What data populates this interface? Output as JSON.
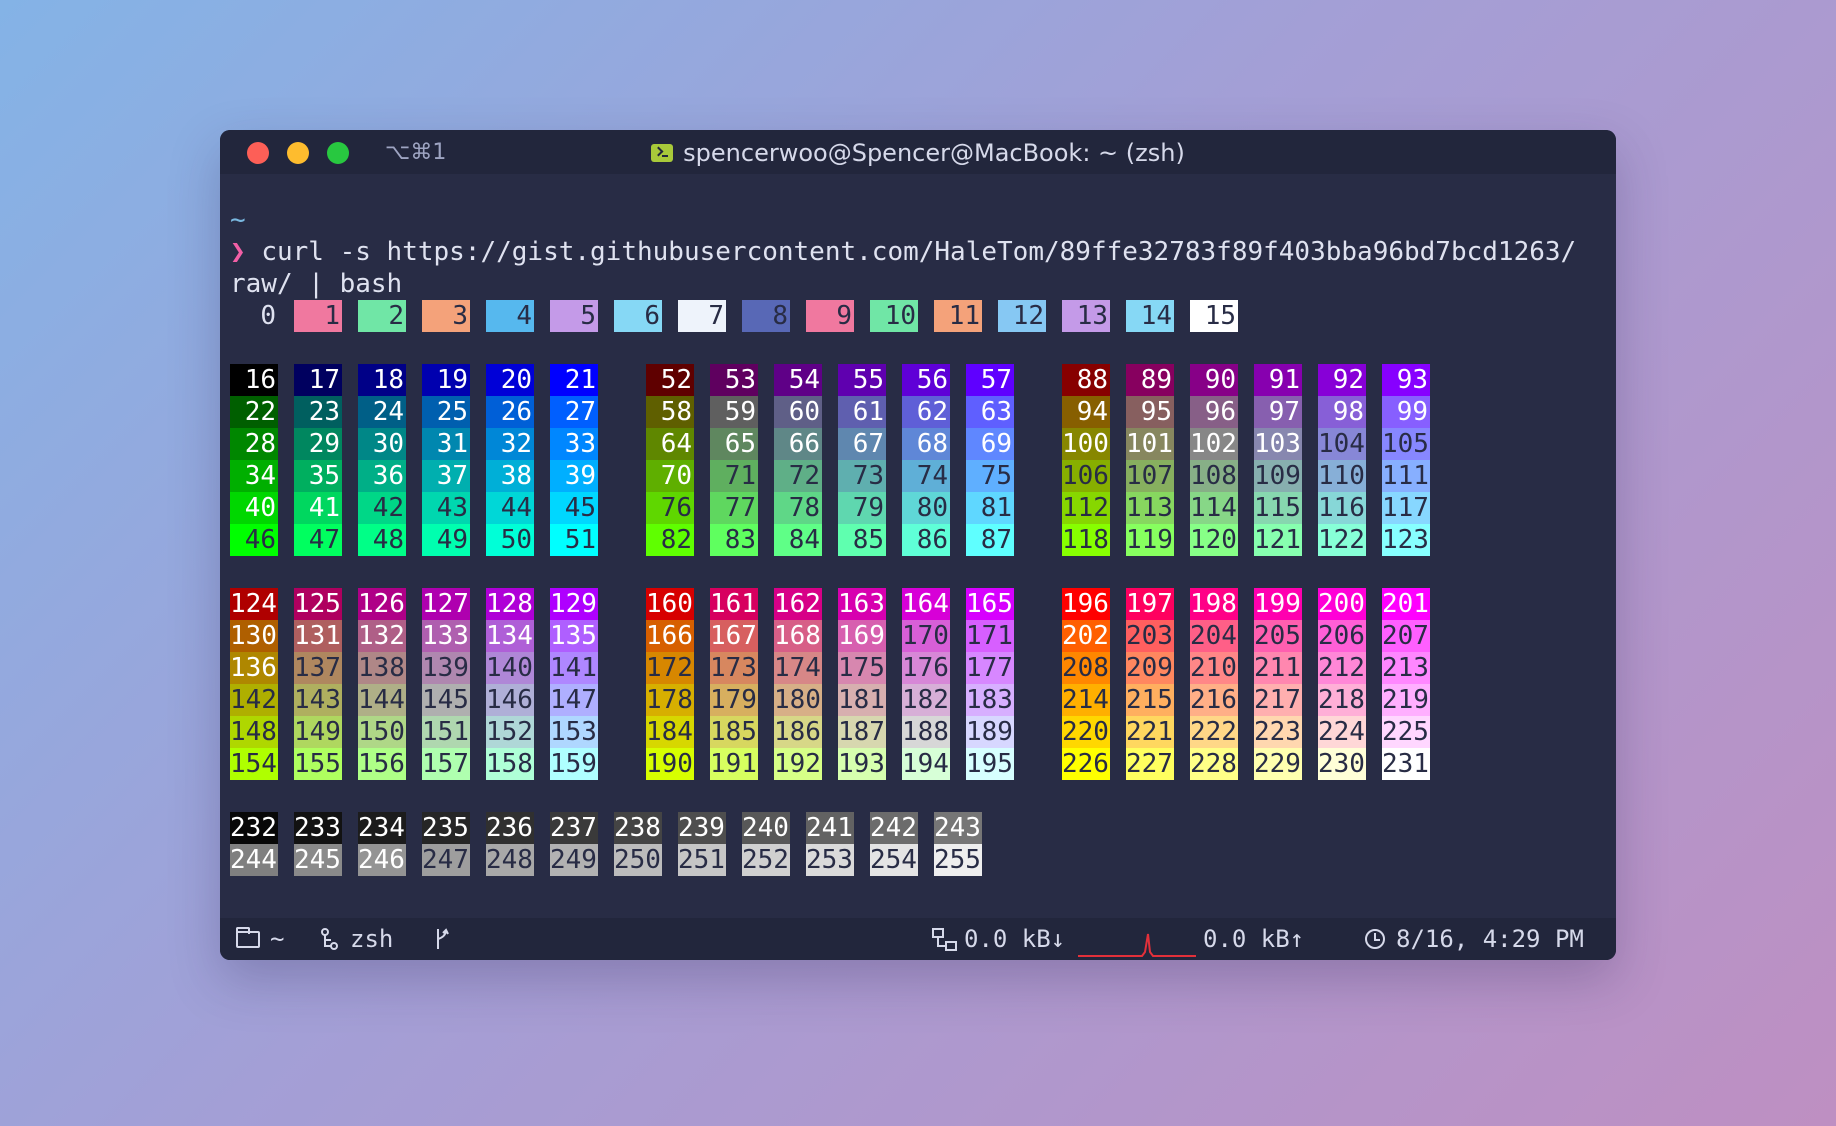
{
  "window": {
    "shortcut": "⌥⌘1",
    "title": "spencerwoo@Spencer@MacBook: ~ (zsh)"
  },
  "terminal": {
    "cwd_line": "~",
    "prompt_symbol": "❯",
    "command_line1": "curl -s https://gist.githubusercontent.com/HaleTom/89ffe32783f89f403bba96bd7bcd1263/",
    "command_line2": "raw/ | bash"
  },
  "ansi16": [
    {
      "n": "0",
      "bg": "#282c45",
      "fg": "#dfe2f0"
    },
    {
      "n": "1",
      "bg": "#f0789f",
      "fg": "#282c45"
    },
    {
      "n": "2",
      "bg": "#70e6a6",
      "fg": "#282c45"
    },
    {
      "n": "3",
      "bg": "#f4a27a",
      "fg": "#282c45"
    },
    {
      "n": "4",
      "bg": "#56b8ee",
      "fg": "#282c45"
    },
    {
      "n": "5",
      "bg": "#c49ae8",
      "fg": "#282c45"
    },
    {
      "n": "6",
      "bg": "#86d8f5",
      "fg": "#282c45"
    },
    {
      "n": "7",
      "bg": "#eef3fb",
      "fg": "#282c45"
    },
    {
      "n": "8",
      "bg": "#5868b6",
      "fg": "#282c45"
    },
    {
      "n": "9",
      "bg": "#f0789f",
      "fg": "#282c45"
    },
    {
      "n": "10",
      "bg": "#70e6a6",
      "fg": "#282c45"
    },
    {
      "n": "11",
      "bg": "#f4a27a",
      "fg": "#282c45"
    },
    {
      "n": "12",
      "bg": "#86c8f3",
      "fg": "#282c45"
    },
    {
      "n": "13",
      "bg": "#c49ae8",
      "fg": "#282c45"
    },
    {
      "n": "14",
      "bg": "#86d8f5",
      "fg": "#282c45"
    },
    {
      "n": "15",
      "bg": "#ffffff",
      "fg": "#282c45"
    }
  ],
  "statusbar": {
    "cwd": "~",
    "shell": "zsh",
    "net_down": "0.0 kB↓",
    "net_up": "0.0 kB↑",
    "datetime": "8/16, 4:29 PM",
    "sparkline_color": "#e3303a"
  }
}
